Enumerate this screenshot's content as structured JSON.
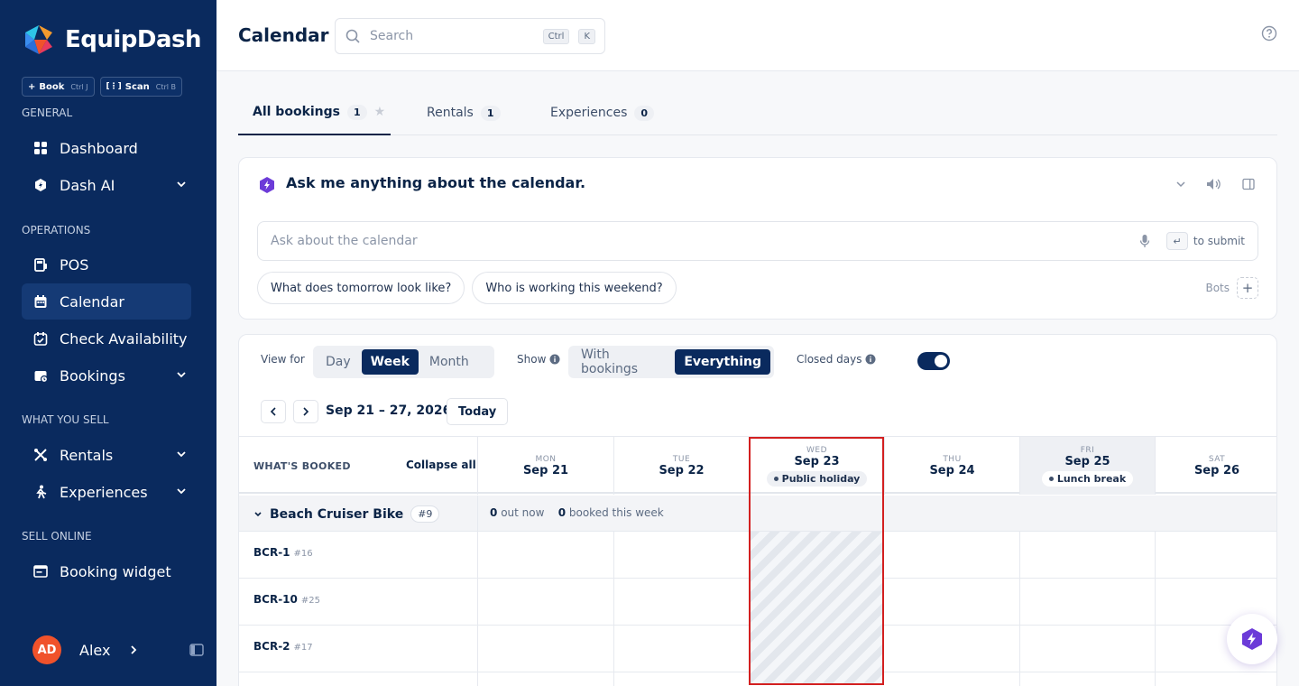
{
  "app": {
    "brand": "EquipDash",
    "quick_actions": [
      {
        "label": "Book",
        "shortcut": "Ctrl J"
      },
      {
        "label": "Scan",
        "shortcut": "Ctrl B"
      }
    ]
  },
  "sidebar": {
    "sections": [
      "GENERAL",
      "OPERATIONS",
      "WHAT YOU SELL",
      "SELL ONLINE"
    ],
    "items": [
      {
        "label": "Dashboard",
        "icon": "grid-icon"
      },
      {
        "label": "Dash AI",
        "icon": "ai-icon"
      },
      {
        "label": "POS",
        "icon": "pos-icon"
      },
      {
        "label": "Calendar",
        "icon": "calendar-icon"
      },
      {
        "label": "Check Availability",
        "icon": "calendar-check-icon"
      },
      {
        "label": "Bookings",
        "icon": "bookings-icon"
      },
      {
        "label": "Rentals",
        "icon": "rentals-icon"
      },
      {
        "label": "Experiences",
        "icon": "experiences-icon"
      },
      {
        "label": "Booking widget",
        "icon": "widget-icon"
      }
    ],
    "user": {
      "initials": "AD",
      "name": "Alex"
    }
  },
  "header": {
    "title": "Calendar",
    "search_placeholder": "Search",
    "search_keys": [
      "Ctrl",
      "K"
    ]
  },
  "tabs": [
    {
      "label": "All bookings",
      "count": "1"
    },
    {
      "label": "Rentals",
      "count": "1"
    },
    {
      "label": "Experiences",
      "count": "0"
    }
  ],
  "assistant": {
    "title": "Ask me anything about the calendar.",
    "placeholder": "Ask about the calendar",
    "submit_hint": "to submit",
    "suggestions": [
      "What does tomorrow look like?",
      "Who is working this weekend?"
    ],
    "bots_label": "Bots"
  },
  "calendar": {
    "view_label": "View for",
    "views": [
      "Day",
      "Week",
      "Month"
    ],
    "active_view": "Week",
    "show_label": "Show",
    "show_options": [
      "With bookings",
      "Everything"
    ],
    "active_show": "Everything",
    "closed_days_label": "Closed days",
    "closed_days_on": true,
    "range": "Sep 21 – 27, 2026",
    "today_label": "Today",
    "whats_booked": "WHAT'S BOOKED",
    "collapse_all": "Collapse all",
    "days": [
      {
        "dow": "MON",
        "date": "Sep 21",
        "tag": ""
      },
      {
        "dow": "TUE",
        "date": "Sep 22",
        "tag": ""
      },
      {
        "dow": "WED",
        "date": "Sep 23",
        "tag": "Public holiday"
      },
      {
        "dow": "THU",
        "date": "Sep 24",
        "tag": ""
      },
      {
        "dow": "FRI",
        "date": "Sep 25",
        "tag": "Lunch break"
      },
      {
        "dow": "SAT",
        "date": "Sep 26",
        "tag": ""
      }
    ],
    "group": {
      "name": "Beach Cruiser Bike",
      "count": "#9",
      "out_now": "0",
      "out_now_label": "out now",
      "booked": "0",
      "booked_label": "booked this week"
    },
    "rows": [
      {
        "name": "BCR-1",
        "id": "#16"
      },
      {
        "name": "BCR-10",
        "id": "#25"
      },
      {
        "name": "BCR-2",
        "id": "#17"
      }
    ]
  },
  "colors": {
    "sidebar": "#0a2a5e",
    "accent": "#0a2a5e",
    "ai_purple": "#6c3bd8",
    "highlight": "#d32020"
  }
}
